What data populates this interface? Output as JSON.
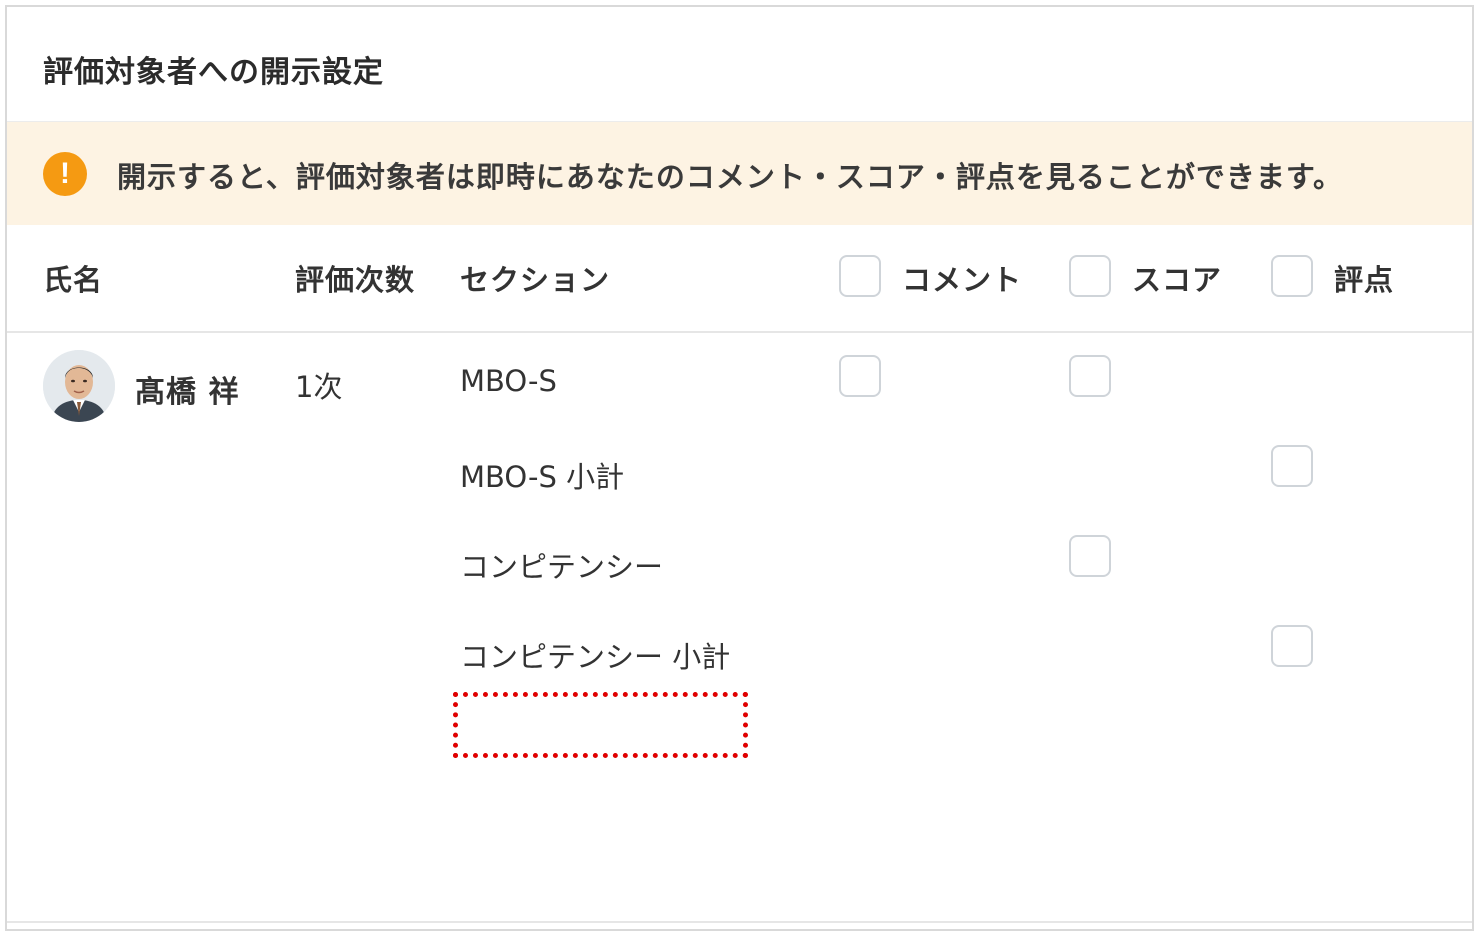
{
  "panel": {
    "title": "評価対象者への開示設定"
  },
  "notice": {
    "icon": "exclamation-icon",
    "icon_glyph": "!",
    "icon_color": "#f59a12",
    "background": "#fdf3e3",
    "text": "開示すると、評価対象者は即時にあなたのコメント・スコア・評点を見ることができます。"
  },
  "table": {
    "columns": {
      "name": "氏名",
      "round": "評価次数",
      "section": "セクション",
      "comment": "コメント",
      "score": "スコア",
      "rating": "評点"
    },
    "header_checkboxes": {
      "comment": false,
      "score": false,
      "rating": false
    },
    "person": {
      "name": "髙橋 祥",
      "round": "1次",
      "avatar": "person-avatar"
    },
    "rows": [
      {
        "section": "MBO-S",
        "comment_checkbox": true,
        "score_checkbox": true,
        "rating_checkbox": false
      },
      {
        "section": "MBO-S 小計",
        "comment_checkbox": false,
        "score_checkbox": false,
        "rating_checkbox": true
      },
      {
        "section": "コンピテンシー",
        "comment_checkbox": false,
        "score_checkbox": true,
        "rating_checkbox": false
      },
      {
        "section": "コンピテンシー 小計",
        "comment_checkbox": false,
        "score_checkbox": false,
        "rating_checkbox": true
      }
    ]
  },
  "highlight": {
    "color": "#e00000",
    "style": "dotted"
  }
}
